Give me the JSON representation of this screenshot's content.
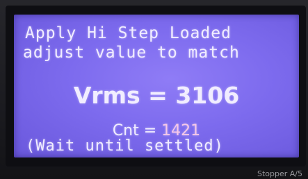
{
  "display": {
    "line1": "Apply Hi Step Loaded",
    "line2": "adjust value to match",
    "vrms_label": "Vrms = ",
    "vrms_value": "3106",
    "cnt_label": "Cnt = ",
    "cnt_value": "1421",
    "line5": "(Wait until settled)"
  },
  "device_label": "Stopper A/5",
  "colors": {
    "screen_background": "#7d6bee",
    "text": "#f1edff",
    "cnt_value": "#f6c7e8"
  }
}
